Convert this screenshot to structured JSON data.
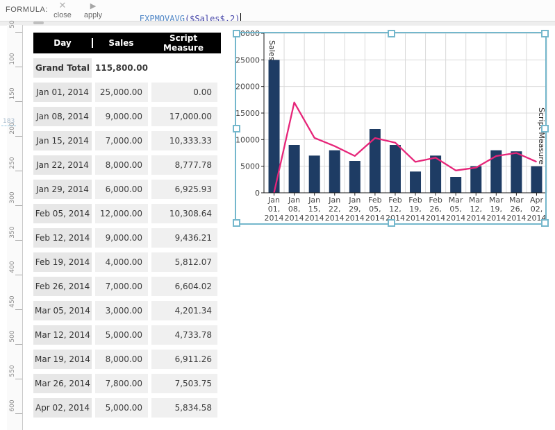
{
  "formula_bar": {
    "label": "FORMULA:",
    "close_label": "close",
    "apply_label": "apply",
    "formula": {
      "func": "EXPMOVAVG",
      "open": "(",
      "arg": "$Sales$",
      "rest": ",2)"
    }
  },
  "ruler": {
    "ticks": [
      50,
      100,
      150,
      200,
      250,
      300,
      350,
      400,
      450,
      500,
      550,
      600
    ],
    "indicator": "183"
  },
  "table": {
    "headers": [
      "Day",
      "Sales",
      "Script Measure"
    ],
    "grand_total": {
      "day": "Grand Total",
      "sales": "115,800.00",
      "script": ""
    },
    "rows": [
      {
        "day": "Jan 01, 2014",
        "sales": "25,000.00",
        "script": "0.00"
      },
      {
        "day": "Jan 08, 2014",
        "sales": "9,000.00",
        "script": "17,000.00"
      },
      {
        "day": "Jan 15, 2014",
        "sales": "7,000.00",
        "script": "10,333.33"
      },
      {
        "day": "Jan 22, 2014",
        "sales": "8,000.00",
        "script": "8,777.78"
      },
      {
        "day": "Jan 29, 2014",
        "sales": "6,000.00",
        "script": "6,925.93"
      },
      {
        "day": "Feb 05, 2014",
        "sales": "12,000.00",
        "script": "10,308.64"
      },
      {
        "day": "Feb 12, 2014",
        "sales": "9,000.00",
        "script": "9,436.21"
      },
      {
        "day": "Feb 19, 2014",
        "sales": "4,000.00",
        "script": "5,812.07"
      },
      {
        "day": "Feb 26, 2014",
        "sales": "7,000.00",
        "script": "6,604.02"
      },
      {
        "day": "Mar 05, 2014",
        "sales": "3,000.00",
        "script": "4,201.34"
      },
      {
        "day": "Mar 12, 2014",
        "sales": "5,000.00",
        "script": "4,733.78"
      },
      {
        "day": "Mar 19, 2014",
        "sales": "8,000.00",
        "script": "6,911.26"
      },
      {
        "day": "Mar 26, 2014",
        "sales": "7,800.00",
        "script": "7,503.75"
      },
      {
        "day": "Apr 02, 2014",
        "sales": "5,000.00",
        "script": "5,834.58"
      }
    ]
  },
  "chart_data": {
    "type": "combo-bar-line",
    "categories": [
      "Jan 01, 2014",
      "Jan 08, 2014",
      "Jan 15, 2014",
      "Jan 22, 2014",
      "Jan 29, 2014",
      "Feb 05, 2014",
      "Feb 12, 2014",
      "Feb 19, 2014",
      "Feb 26, 2014",
      "Mar 05, 2014",
      "Mar 12, 2014",
      "Mar 19, 2014",
      "Mar 26, 2014",
      "Apr 02, 2014"
    ],
    "series": [
      {
        "name": "Sales",
        "type": "bar",
        "values": [
          25000,
          9000,
          7000,
          8000,
          6000,
          12000,
          9000,
          4000,
          7000,
          3000,
          5000,
          8000,
          7800,
          5000
        ]
      },
      {
        "name": "Script Measure",
        "type": "line",
        "values": [
          0,
          17000,
          10333.33,
          8777.78,
          6925.93,
          10308.64,
          9436.21,
          5812.07,
          6604.02,
          4201.34,
          4733.78,
          6911.26,
          7503.75,
          5834.58
        ]
      }
    ],
    "ylim": [
      0,
      30000
    ],
    "ytick_step": 5000,
    "yticks": [
      0,
      5000,
      10000,
      15000,
      20000,
      25000,
      30000
    ],
    "grid": true,
    "legend": "none",
    "colors": {
      "bar": "#1e3c64",
      "line": "#e62579",
      "grid": "#d9d9d9",
      "axis": "#1a1a1a",
      "tick_text": "#3c3c3c",
      "selection": "#74b7cc"
    }
  }
}
